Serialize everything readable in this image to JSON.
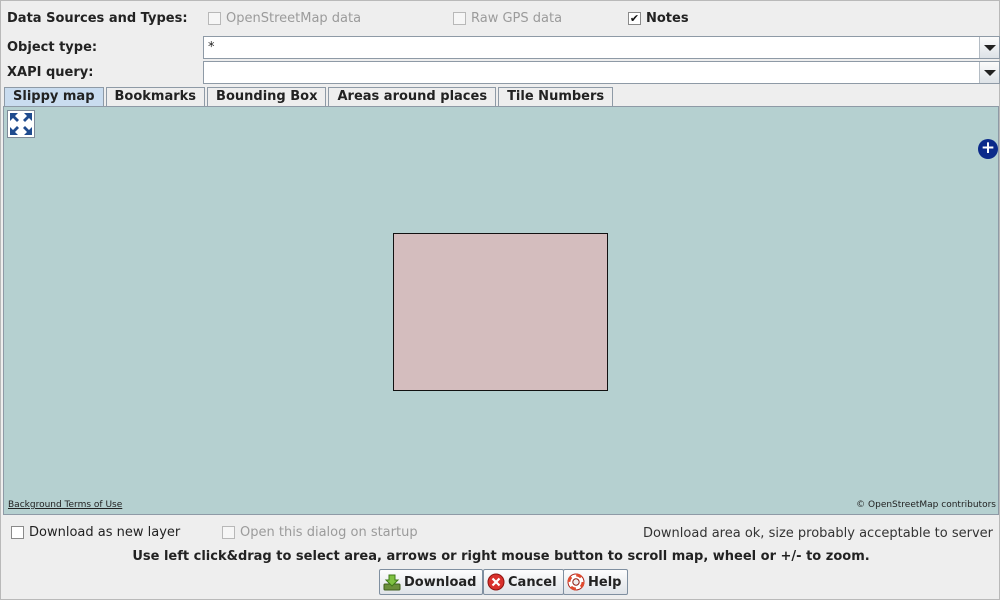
{
  "sources": {
    "label": "Data Sources and Types:",
    "osm": {
      "label": "OpenStreetMap data",
      "checked": false,
      "enabled": false
    },
    "gps": {
      "label": "Raw GPS data",
      "checked": false,
      "enabled": false
    },
    "notes": {
      "label": "Notes",
      "checked": true,
      "enabled": true
    }
  },
  "object_type": {
    "label": "Object type:",
    "value": "*"
  },
  "xapi": {
    "label": "XAPI query:",
    "value": ""
  },
  "tabs": [
    {
      "label": "Slippy map",
      "active": true
    },
    {
      "label": "Bookmarks"
    },
    {
      "label": "Bounding Box"
    },
    {
      "label": "Areas around places"
    },
    {
      "label": "Tile Numbers"
    }
  ],
  "map": {
    "background_color": "#b5d0d0",
    "selection_color": "#d4bdbe",
    "terms_text": "Background Terms of Use",
    "attribution": "© OpenStreetMap contributors"
  },
  "options": {
    "new_layer": {
      "label": "Download as new layer",
      "checked": false
    },
    "startup": {
      "label": "Open this dialog on startup",
      "checked": false,
      "enabled": false
    }
  },
  "status_text": "Download area ok, size probably acceptable to server",
  "hint_text": "Use left click&drag to select area, arrows or right mouse button to scroll map, wheel or +/- to zoom.",
  "buttons": {
    "download": "Download",
    "cancel": "Cancel",
    "help": "Help"
  }
}
